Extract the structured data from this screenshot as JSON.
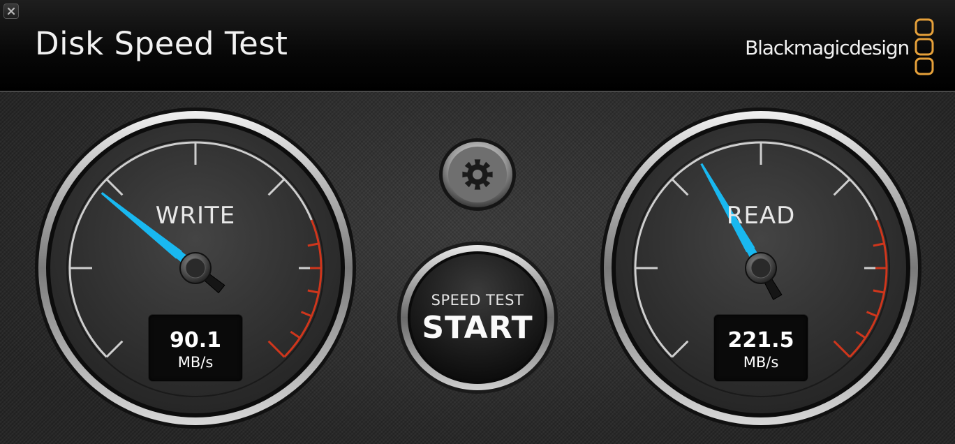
{
  "window": {
    "title": "Disk Speed Test"
  },
  "brand": {
    "text": "Blackmagicdesign",
    "accent": "#e7a13a"
  },
  "write_gauge": {
    "label": "WRITE",
    "value": "90.1",
    "unit": "MB/s",
    "needle_level": 0.31
  },
  "read_gauge": {
    "label": "READ",
    "value": "221.5",
    "unit": "MB/s",
    "needle_level": 0.39
  },
  "start_button": {
    "small_label": "SPEED TEST",
    "big_label": "START"
  },
  "icons": {
    "close": "close-icon",
    "settings": "gear-icon",
    "brand_mark": "blackmagic-logo-icon"
  },
  "colors": {
    "needle": "#19b8f0",
    "redzone": "#d0361c",
    "background": "#2e2e2e"
  }
}
